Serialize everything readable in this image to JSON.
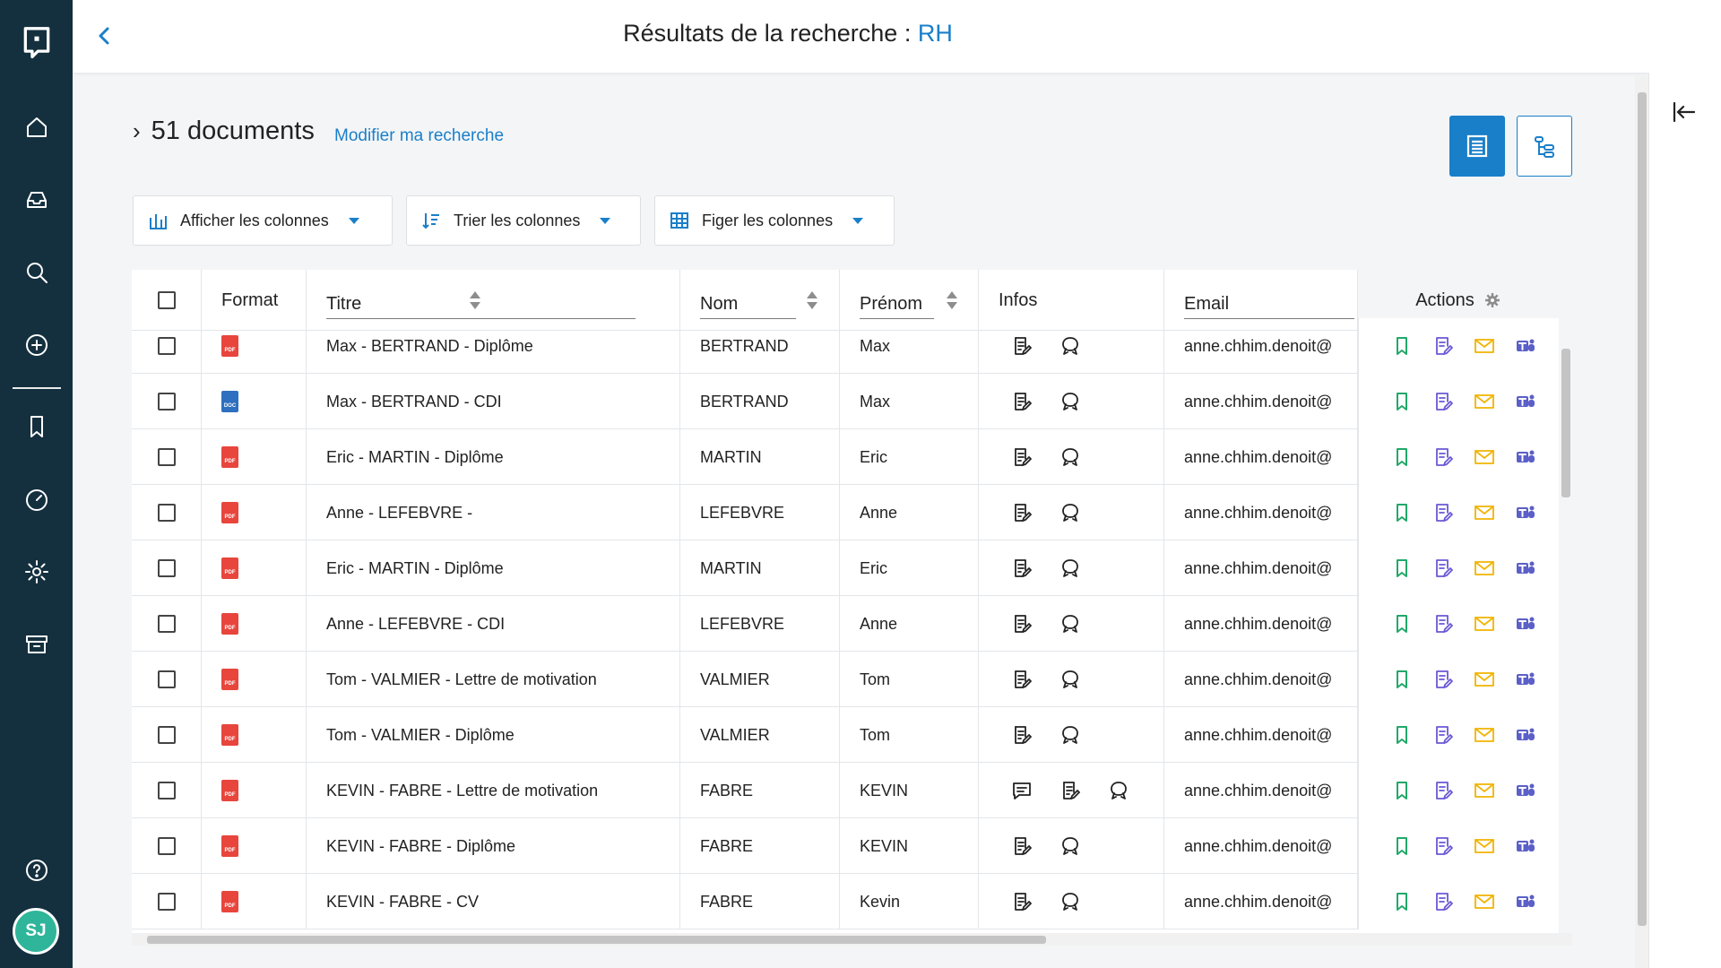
{
  "header": {
    "title_prefix": "Résultats de la recherche :",
    "query": "RH"
  },
  "user": {
    "initials": "SJ"
  },
  "results": {
    "count_label": "51 documents",
    "modify_label": "Modifier ma recherche"
  },
  "toolbar": {
    "show_columns": "Afficher les colonnes",
    "sort_columns": "Trier les colonnes",
    "freeze_columns": "Figer les colonnes"
  },
  "columns": {
    "format": "Format",
    "titre": "Titre",
    "nom": "Nom",
    "prenom": "Prénom",
    "infos": "Infos",
    "email": "Email",
    "actions": "Actions"
  },
  "rows": [
    {
      "format": "pdf",
      "titre": "Max - BERTRAND - Diplôme",
      "nom": "BERTRAND",
      "prenom": "Max",
      "comment": false,
      "email": "anne.chhim.denoit@"
    },
    {
      "format": "doc",
      "titre": "Max - BERTRAND - CDI",
      "nom": "BERTRAND",
      "prenom": "Max",
      "comment": false,
      "email": "anne.chhim.denoit@"
    },
    {
      "format": "pdf",
      "titre": "Eric - MARTIN - Diplôme",
      "nom": "MARTIN",
      "prenom": "Eric",
      "comment": false,
      "email": "anne.chhim.denoit@"
    },
    {
      "format": "pdf",
      "titre": "Anne - LEFEBVRE -",
      "nom": "LEFEBVRE",
      "prenom": "Anne",
      "comment": false,
      "email": "anne.chhim.denoit@"
    },
    {
      "format": "pdf",
      "titre": "Eric - MARTIN - Diplôme",
      "nom": "MARTIN",
      "prenom": "Eric",
      "comment": false,
      "email": "anne.chhim.denoit@"
    },
    {
      "format": "pdf",
      "titre": "Anne - LEFEBVRE - CDI",
      "nom": "LEFEBVRE",
      "prenom": "Anne",
      "comment": false,
      "email": "anne.chhim.denoit@"
    },
    {
      "format": "pdf",
      "titre": "Tom - VALMIER - Lettre de motivation",
      "nom": "VALMIER",
      "prenom": "Tom",
      "comment": false,
      "email": "anne.chhim.denoit@"
    },
    {
      "format": "pdf",
      "titre": "Tom - VALMIER - Diplôme",
      "nom": "VALMIER",
      "prenom": "Tom",
      "comment": false,
      "email": "anne.chhim.denoit@"
    },
    {
      "format": "pdf",
      "titre": "KEVIN - FABRE - Lettre de motivation",
      "nom": "FABRE",
      "prenom": "KEVIN",
      "comment": true,
      "email": "anne.chhim.denoit@"
    },
    {
      "format": "pdf",
      "titre": "KEVIN - FABRE - Diplôme",
      "nom": "FABRE",
      "prenom": "KEVIN",
      "comment": false,
      "email": "anne.chhim.denoit@"
    },
    {
      "format": "pdf",
      "titre": "KEVIN - FABRE - CV",
      "nom": "FABRE",
      "prenom": "Kevin",
      "comment": false,
      "email": "anne.chhim.denoit@"
    }
  ],
  "format_labels": {
    "pdf": "PDF",
    "doc": "DOC"
  },
  "colors": {
    "accent": "#1a7fc9",
    "sidebar": "#14303f",
    "avatar": "#2fb59a",
    "bookmark": "#22a86a",
    "edit": "#6a58d6",
    "mail": "#f0b400",
    "teams": "#5b5fc7"
  }
}
